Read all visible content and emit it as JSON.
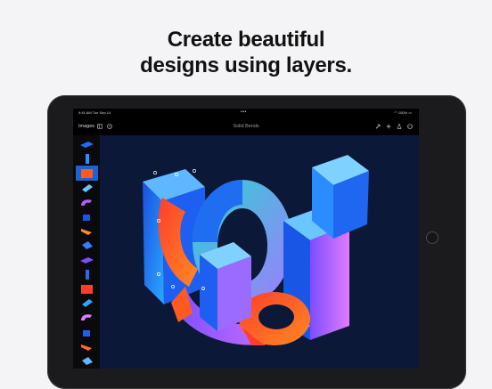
{
  "headline": {
    "line1": "Create beautiful",
    "line2": "designs using layers."
  },
  "status_bar": {
    "time": "9:41 AM  Tue Sep 14",
    "multitask_dots": "•••",
    "battery": "100%"
  },
  "toolbar": {
    "images_label": "Images",
    "document_title": "Solid Bends",
    "icons": [
      "sidebar-icon",
      "history-icon",
      "hammer-icon",
      "add-icon",
      "export-icon",
      "more-icon"
    ]
  },
  "layers_panel": {
    "selected_index": 2,
    "count": 16
  },
  "colors": {
    "canvas_background": "#0c1837",
    "selection": "#1a63d6",
    "artwork_blue": "#1f6ef2",
    "artwork_orange": "#ff5a1f",
    "artwork_purple": "#b65cf5"
  }
}
